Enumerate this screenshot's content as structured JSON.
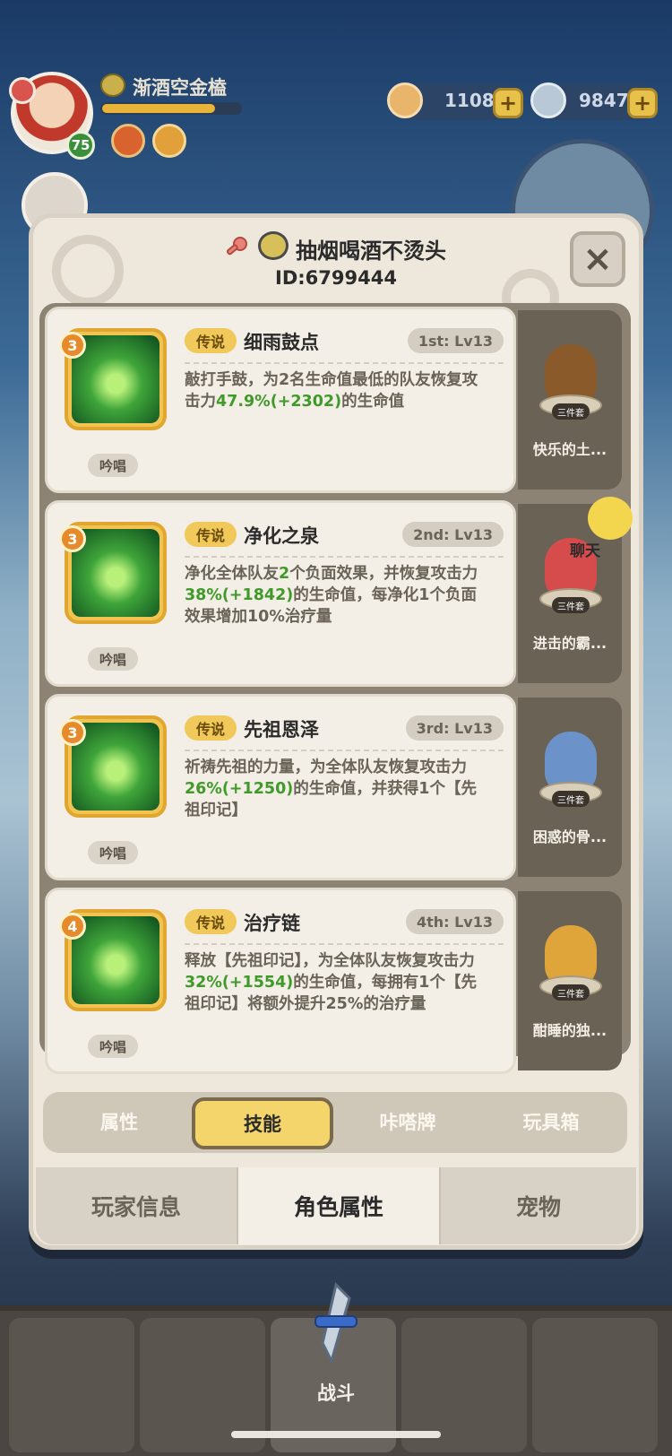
{
  "hud": {
    "player_name": "渐酒空金榼",
    "level": "75",
    "xp_fraction": 0.8,
    "resources": [
      {
        "icon": "shell-icon",
        "value": "1108"
      },
      {
        "icon": "pearl-icon",
        "value": "9847"
      }
    ],
    "plus_label": "+"
  },
  "dialog": {
    "player_name": "抽烟喝酒不烫头",
    "player_id": "ID:6799444",
    "close_label": "×"
  },
  "skills": [
    {
      "badge": "3",
      "rarity": "传说",
      "name": "细雨鼓点",
      "level": "1st: Lv13",
      "cast": "吟唱",
      "desc": [
        {
          "t": "敲打手鼓，为2名生命值最低的队友恢复攻击力"
        },
        {
          "t": "47.9%(+2302)",
          "g": true
        },
        {
          "t": "的生命值"
        }
      ],
      "pet": {
        "name": "快乐的土...",
        "tag": "三件套",
        "color": "#8b5a2b"
      }
    },
    {
      "badge": "3",
      "rarity": "传说",
      "name": "净化之泉",
      "level": "2nd: Lv13",
      "cast": "吟唱",
      "desc": [
        {
          "t": "净化全体队友"
        },
        {
          "t": "2",
          "g": true
        },
        {
          "t": "个负面效果，并恢复攻击力"
        },
        {
          "t": "38%(+1842)",
          "g": true
        },
        {
          "t": "的生命值，每净化1个负面效果增加10%治疗量"
        }
      ],
      "pet": {
        "name": "进击的霸...",
        "tag": "三件套",
        "color": "#d64c4c"
      }
    },
    {
      "badge": "3",
      "rarity": "传说",
      "name": "先祖恩泽",
      "level": "3rd: Lv13",
      "cast": "吟唱",
      "desc": [
        {
          "t": "祈祷先祖的力量，为全体队友恢复攻击力"
        },
        {
          "t": "26%(+1250)",
          "g": true
        },
        {
          "t": "的生命值，并获得1个【先祖印记】"
        }
      ],
      "pet": {
        "name": "困惑的骨...",
        "tag": "三件套",
        "color": "#6c93c9"
      }
    },
    {
      "badge": "4",
      "rarity": "传说",
      "name": "治疗链",
      "level": "4th: Lv13",
      "cast": "吟唱",
      "desc": [
        {
          "t": "释放【先祖印记】，为全体队友恢复攻击力"
        },
        {
          "t": "32%(+1554)",
          "g": true
        },
        {
          "t": "的生命值，每拥有1个【先祖印记】将额外提升25%的治疗量"
        }
      ],
      "pet": {
        "name": "酣睡的独...",
        "tag": "三件套",
        "color": "#e0a53a"
      }
    }
  ],
  "chat": {
    "label": "聊天"
  },
  "subtabs": [
    "属性",
    "技能",
    "咔嗒牌",
    "玩具箱"
  ],
  "subtab_active": "技能",
  "maintabs": [
    "玩家信息",
    "角色属性",
    "宠物"
  ],
  "maintab_active": "角色属性",
  "bottom_nav": {
    "battle_label": "战斗"
  }
}
